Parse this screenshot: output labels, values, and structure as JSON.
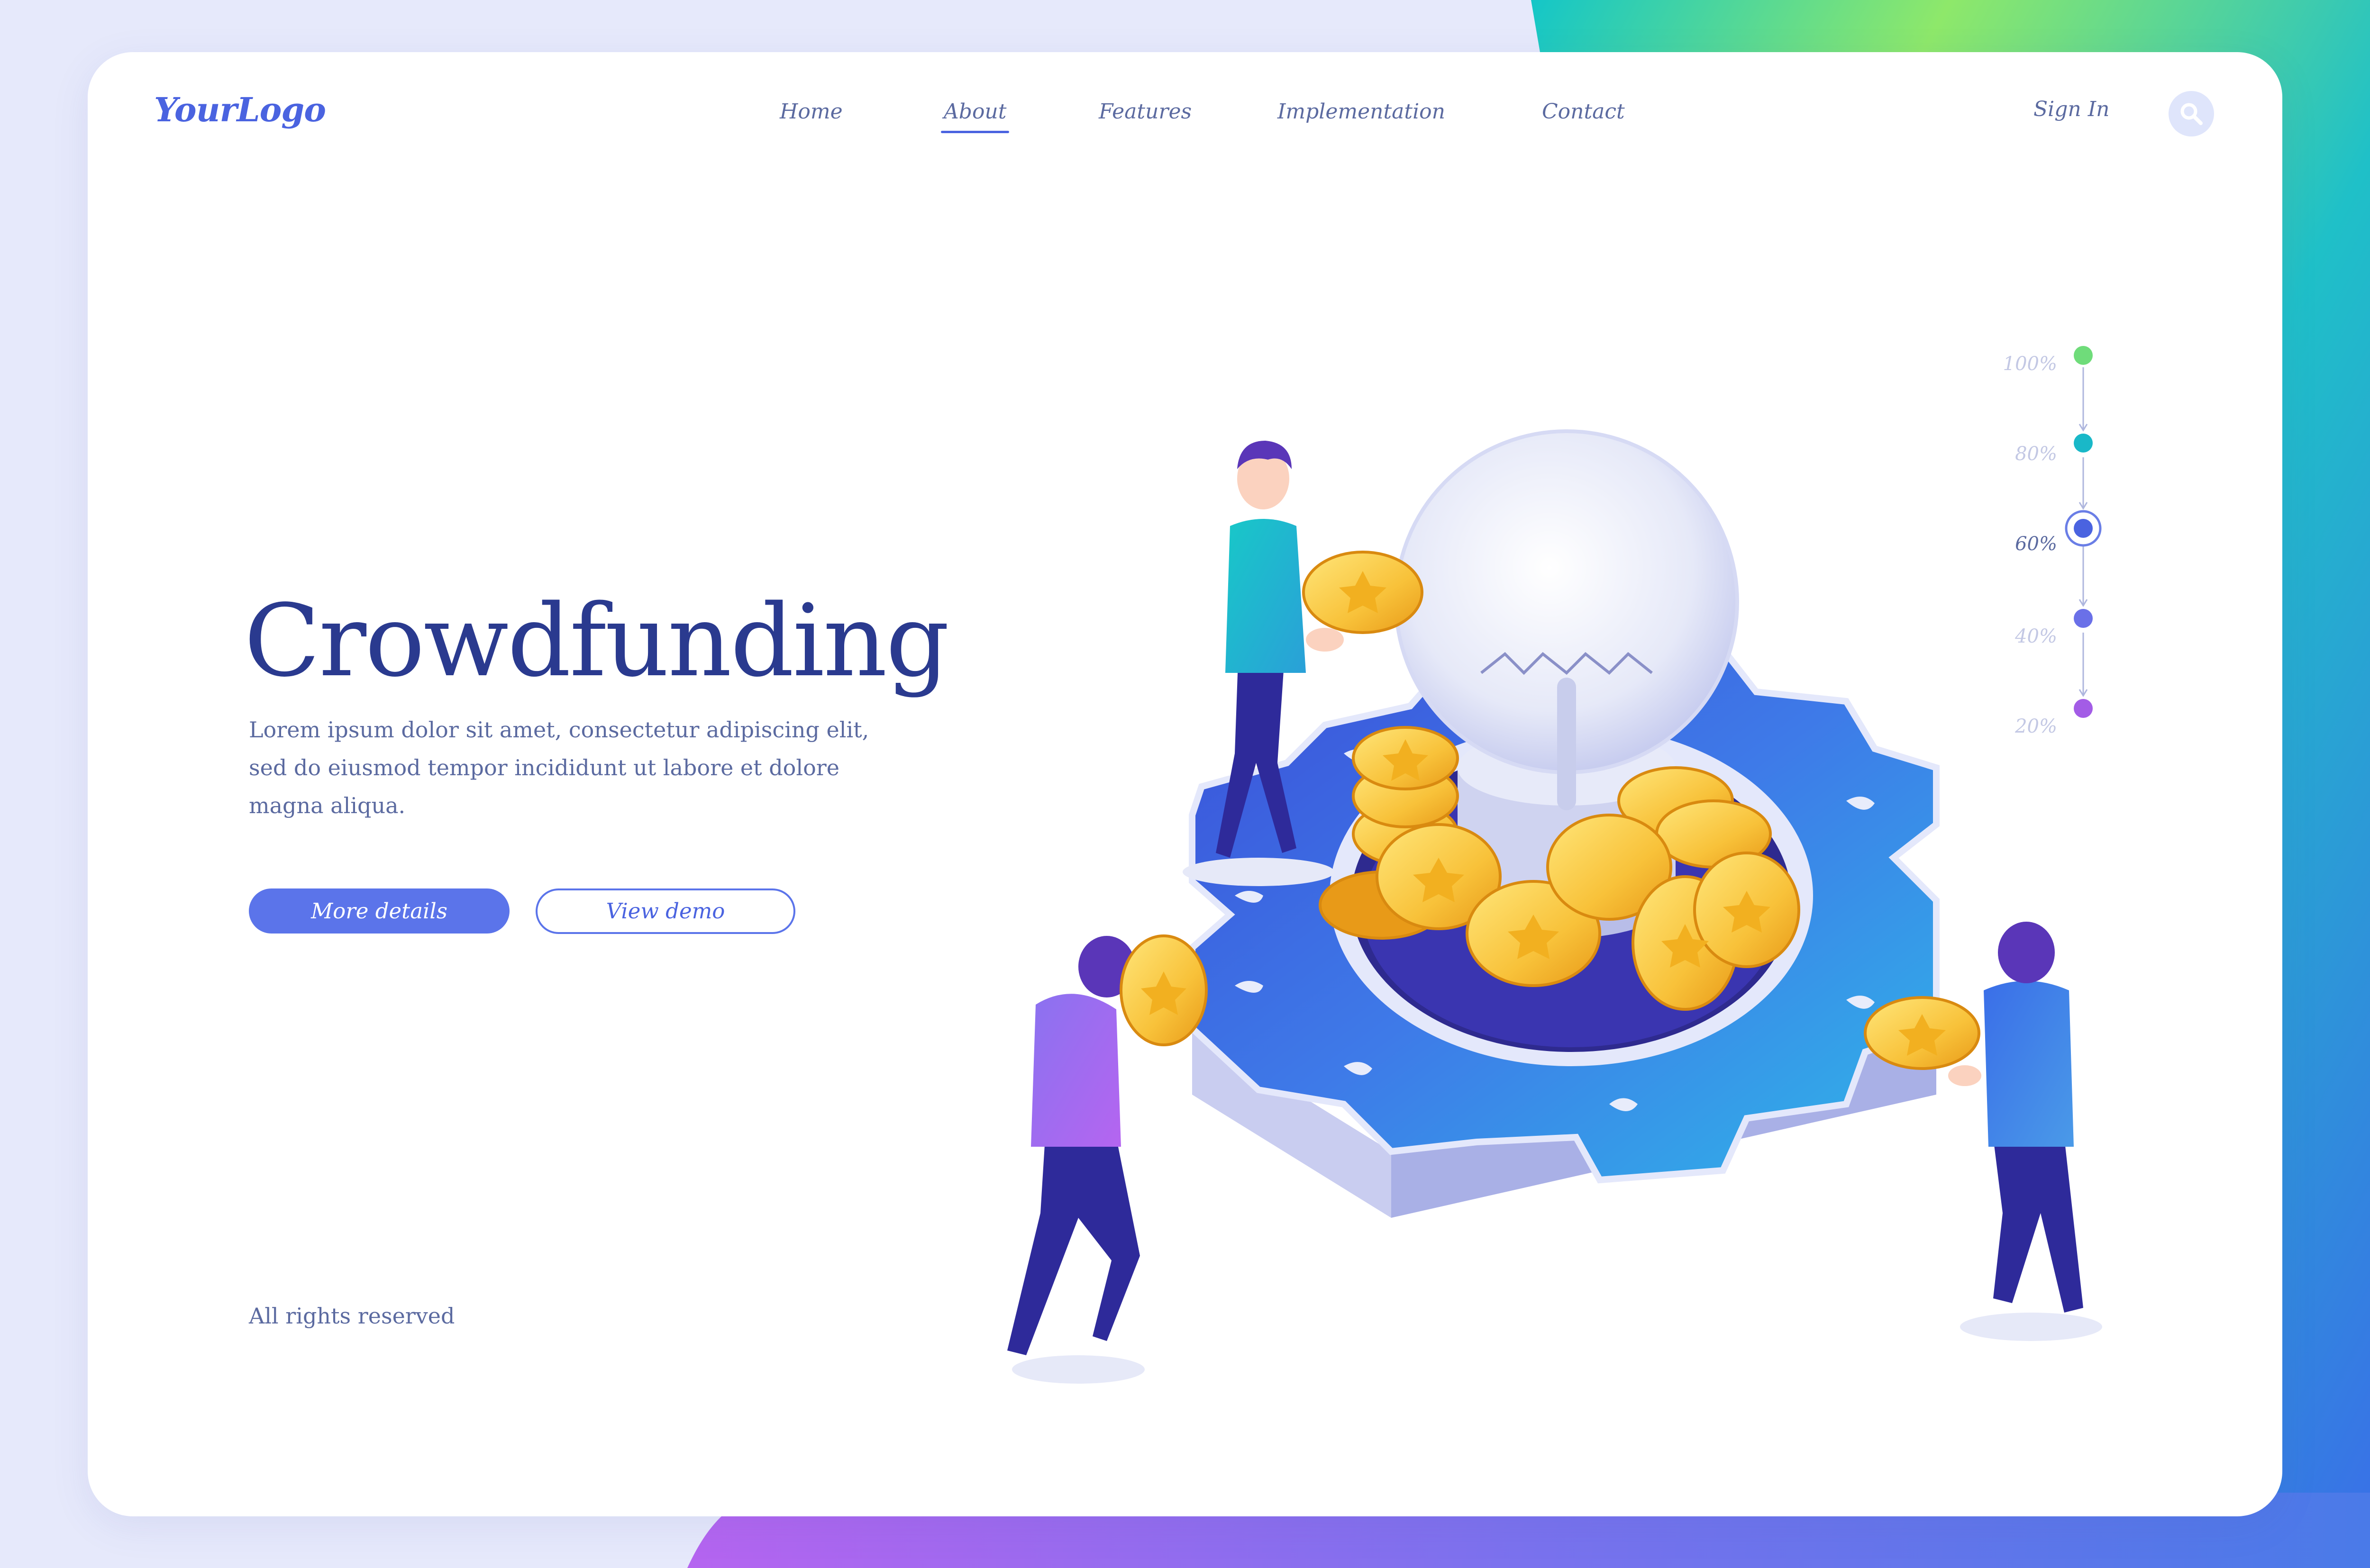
{
  "brand": {
    "logo": "YourLogo"
  },
  "nav": {
    "items": [
      {
        "label": "Home",
        "active": false
      },
      {
        "label": "About",
        "active": true
      },
      {
        "label": "Features",
        "active": false
      },
      {
        "label": "Implementation",
        "active": false
      },
      {
        "label": "Contact",
        "active": false
      }
    ],
    "sign_in": "Sign In",
    "search_icon": "search-icon"
  },
  "hero": {
    "title": "Crowdfunding",
    "description_lines": [
      "Lorem ipsum dolor sit amet, consectetur adipiscing elit,",
      "sed do eiusmod tempor incididunt ut labore et dolore",
      "magna aliqua."
    ],
    "primary_button": "More details",
    "secondary_button": "View demo"
  },
  "progress": {
    "steps": [
      {
        "label": "100%",
        "color": "#6fdc7a",
        "active": false
      },
      {
        "label": "80%",
        "color": "#19b8c8",
        "active": false
      },
      {
        "label": "60%",
        "color": "#4a63e0",
        "active": true
      },
      {
        "label": "40%",
        "color": "#6a70e8",
        "active": false
      },
      {
        "label": "20%",
        "color": "#a35ce6",
        "active": false
      }
    ],
    "current_value": 60
  },
  "footer": {
    "text": "All rights reserved"
  },
  "colors": {
    "accent": "#4a63e0",
    "title": "#2a3a8f",
    "text": "#5b6aa0",
    "gradient_green": "#8ee86a",
    "gradient_teal": "#12c8c4",
    "gradient_blue": "#3a7ae6",
    "gradient_purple": "#b565f0"
  }
}
